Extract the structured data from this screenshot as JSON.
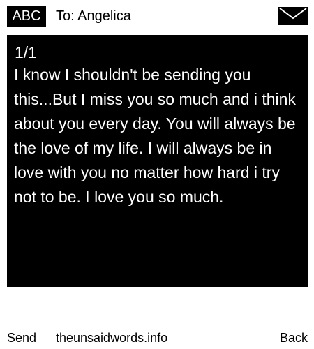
{
  "header": {
    "mode_label": "ABC",
    "recipient": "To: Angelica",
    "icon": "envelope-icon"
  },
  "message": {
    "page_indicator": "1/1",
    "body": "I know I shouldn't be sending you this...But I miss you so much and i think about you every day. You will always be the love of my life. I will always be in love with you no matter how hard i try not to be. I love you so much."
  },
  "softkeys": {
    "left": "Send",
    "center": "theunsaidwords.info",
    "right": "Back"
  },
  "colors": {
    "panel_background": "#000000",
    "panel_text": "#ffffff",
    "page_background": "#ffffff"
  }
}
